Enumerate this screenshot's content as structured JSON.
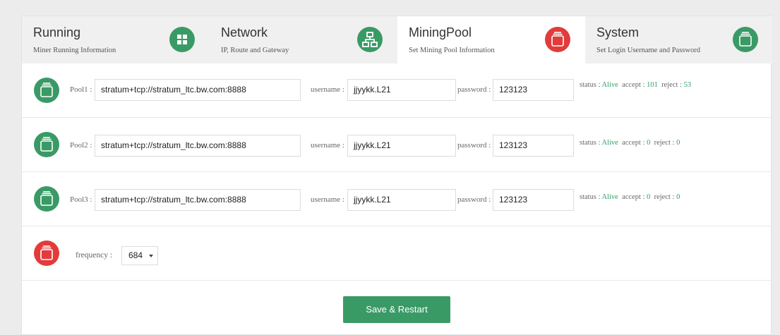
{
  "tabs": [
    {
      "title": "Running",
      "subtitle": "Miner Running Information",
      "icon": "grid-icon",
      "color": "#3a9a66"
    },
    {
      "title": "Network",
      "subtitle": "IP, Route and Gateway",
      "icon": "network-icon",
      "color": "#3a9a66"
    },
    {
      "title": "MiningPool",
      "subtitle": "Set Mining Pool Information",
      "icon": "stack-icon",
      "color": "#e23b3b"
    },
    {
      "title": "System",
      "subtitle": "Set Login Username and Password",
      "icon": "stack-icon",
      "color": "#3a9a66"
    }
  ],
  "pools": [
    {
      "label": "Pool1 :",
      "url": "stratum+tcp://stratum_ltc.bw.com:8888",
      "username_label": "username :",
      "username": "jjyykk.L21",
      "password_label": "password :",
      "password": "123123",
      "status_label": "status :",
      "status": "Alive",
      "accept_label": "accept :",
      "accept": "101",
      "reject_label": "reject :",
      "reject": "53"
    },
    {
      "label": "Pool2 :",
      "url": "stratum+tcp://stratum_ltc.bw.com:8888",
      "username_label": "username :",
      "username": "jjyykk.L21",
      "password_label": "password :",
      "password": "123123",
      "status_label": "status :",
      "status": "Alive",
      "accept_label": "accept :",
      "accept": "0",
      "reject_label": "reject :",
      "reject": "0"
    },
    {
      "label": "Pool3 :",
      "url": "stratum+tcp://stratum_ltc.bw.com:8888",
      "username_label": "username :",
      "username": "jjyykk.L21",
      "password_label": "password :",
      "password": "123123",
      "status_label": "status :",
      "status": "Alive",
      "accept_label": "accept :",
      "accept": "0",
      "reject_label": "reject :",
      "reject": "0"
    }
  ],
  "frequency": {
    "label": "frequency :",
    "value": "684"
  },
  "save_button": "Save & Restart",
  "colors": {
    "green": "#3a9a66",
    "red": "#e23b3b",
    "status_green": "#2e9f63"
  }
}
